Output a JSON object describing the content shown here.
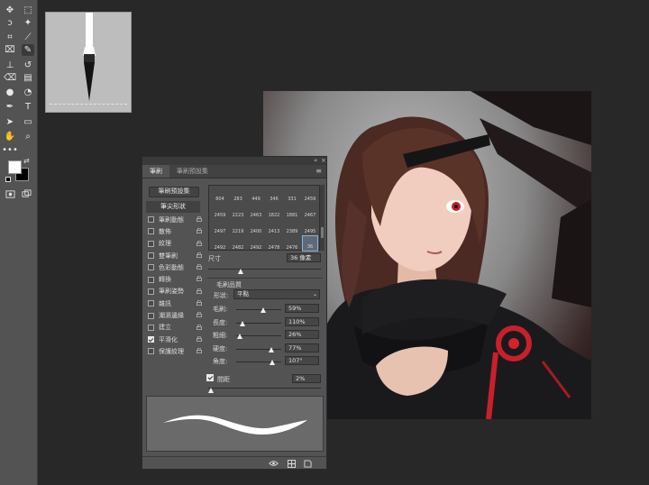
{
  "toolbar": {
    "tools": [
      {
        "name": "move-tool-icon",
        "glyph": "✥"
      },
      {
        "name": "marquee-tool-icon",
        "glyph": "⬚"
      },
      {
        "name": "lasso-tool-icon",
        "glyph": "ↄ"
      },
      {
        "name": "magic-wand-tool-icon",
        "glyph": "✦"
      },
      {
        "name": "crop-tool-icon",
        "glyph": "⌗"
      },
      {
        "name": "eyedropper-tool-icon",
        "glyph": "⟋"
      },
      {
        "name": "healing-brush-tool-icon",
        "glyph": "⌧"
      },
      {
        "name": "brush-tool-icon",
        "glyph": "✎"
      },
      {
        "name": "clone-stamp-tool-icon",
        "glyph": "⊥"
      },
      {
        "name": "history-brush-tool-icon",
        "glyph": "↺"
      },
      {
        "name": "eraser-tool-icon",
        "glyph": "⌫"
      },
      {
        "name": "gradient-tool-icon",
        "glyph": "▤"
      },
      {
        "name": "blur-tool-icon",
        "glyph": "●"
      },
      {
        "name": "dodge-tool-icon",
        "glyph": "◔"
      },
      {
        "name": "pen-tool-icon",
        "glyph": "✒"
      },
      {
        "name": "type-tool-icon",
        "glyph": "T"
      },
      {
        "name": "path-selection-tool-icon",
        "glyph": "➤"
      },
      {
        "name": "rectangle-tool-icon",
        "glyph": "▭"
      },
      {
        "name": "hand-tool-icon",
        "glyph": "✋"
      },
      {
        "name": "zoom-tool-icon",
        "glyph": "⌕"
      },
      {
        "name": "more-tools-icon",
        "glyph": "•••"
      }
    ],
    "foreground_color": "#ffffff",
    "background_color": "#000000"
  },
  "panel": {
    "tabs": [
      {
        "label": "筆刷",
        "active": true
      },
      {
        "label": "筆刷預設集",
        "active": false
      }
    ],
    "presets_button": "筆刷預設集",
    "tip_shape_label": "筆尖形狀",
    "options": [
      {
        "label": "筆刷動態",
        "checked": false
      },
      {
        "label": "散佈",
        "checked": false
      },
      {
        "label": "紋理",
        "checked": false
      },
      {
        "label": "雙筆刷",
        "checked": false
      },
      {
        "label": "色彩動態",
        "checked": false
      },
      {
        "label": "轉換",
        "checked": false
      },
      {
        "label": "筆刷姿勢",
        "checked": false
      },
      {
        "label": "雜訊",
        "checked": false
      },
      {
        "label": "潮濕邊緣",
        "checked": false
      },
      {
        "label": "建立",
        "checked": false
      },
      {
        "label": "平滑化",
        "checked": true
      },
      {
        "label": "保護紋理",
        "checked": false
      }
    ],
    "tips": [
      [
        "604",
        "283",
        "449",
        "346",
        "331",
        "2459"
      ],
      [
        "2459",
        "2223",
        "2463",
        "1822",
        "1881",
        "2467"
      ],
      [
        "2497",
        "2219",
        "2400",
        "2413",
        "2389",
        "2495"
      ],
      [
        "2492",
        "2482",
        "2492",
        "2478",
        "2476",
        "36"
      ]
    ],
    "size_label": "尺寸",
    "size_value": "36 像素",
    "size_fraction": 0.29,
    "quality_label": "毛刷品質",
    "shape_label": "形狀:",
    "shape_value": "平點",
    "params": [
      {
        "label": "毛刷:",
        "value": "59%",
        "fraction": 0.59
      },
      {
        "label": "長度:",
        "value": "110%",
        "fraction": 0.14
      },
      {
        "label": "粗細:",
        "value": "26%",
        "fraction": 0.07
      },
      {
        "label": "硬度:",
        "value": "77%",
        "fraction": 0.77
      },
      {
        "label": "角度:",
        "value": "107°",
        "fraction": 0.8
      }
    ],
    "spacing_label": "間距",
    "spacing_value": "2%",
    "spacing_fraction": 0.02
  }
}
